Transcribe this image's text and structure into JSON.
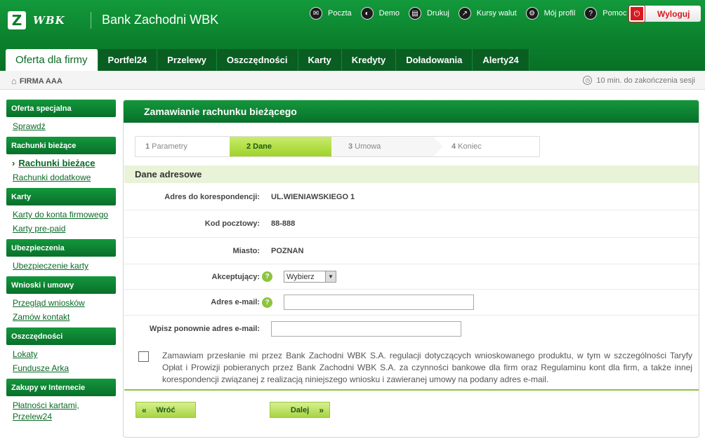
{
  "brand": {
    "logo_mark": "Z",
    "logo_text": "WBK",
    "bank_name": "Bank Zachodni WBK"
  },
  "top_links": [
    {
      "label": "Poczta",
      "icon": "mail-icon",
      "glyph": "✉"
    },
    {
      "label": "Demo",
      "icon": "demo-icon",
      "glyph": "◐"
    },
    {
      "label": "Drukuj",
      "icon": "print-icon",
      "glyph": "▤"
    },
    {
      "label": "Kursy walut",
      "icon": "chart-icon",
      "glyph": "↗"
    },
    {
      "label": "Mój profil",
      "icon": "gear-icon",
      "glyph": "⚙"
    },
    {
      "label": "Pomoc",
      "icon": "help-icon",
      "glyph": "?"
    }
  ],
  "logout": {
    "label": "Wyloguj",
    "glyph": "⏻"
  },
  "tabs": [
    {
      "label": "Oferta dla firmy",
      "active": true
    },
    {
      "label": "Portfel24"
    },
    {
      "label": "Przelewy"
    },
    {
      "label": "Oszczędności"
    },
    {
      "label": "Karty"
    },
    {
      "label": "Kredyty"
    },
    {
      "label": "Doładowania"
    },
    {
      "label": "Alerty24"
    }
  ],
  "subbar": {
    "firm_name": "FIRMA AAA",
    "session": "10 min. do zakończenia sesji"
  },
  "sidebar": [
    {
      "title": "Oferta specjalna",
      "items": [
        {
          "label": "Sprawdź"
        }
      ]
    },
    {
      "title": "Rachunki bieżące",
      "items": [
        {
          "label": "Rachunki bieżące",
          "current": true
        },
        {
          "label": "Rachunki dodatkowe"
        }
      ]
    },
    {
      "title": "Karty",
      "items": [
        {
          "label": "Karty do konta firmowego"
        },
        {
          "label": "Karty pre-paid"
        }
      ]
    },
    {
      "title": "Ubezpieczenia",
      "items": [
        {
          "label": "Ubezpieczenie karty"
        }
      ]
    },
    {
      "title": "Wnioski i umowy",
      "items": [
        {
          "label": "Przegląd wniosków"
        },
        {
          "label": "Zamów kontakt"
        }
      ]
    },
    {
      "title": "Oszczędności",
      "items": [
        {
          "label": "Lokaty"
        },
        {
          "label": "Fundusze Arka"
        }
      ]
    },
    {
      "title": "Zakupy w Internecie",
      "items": [
        {
          "label": "Płatności kartami, Przelew24"
        }
      ]
    }
  ],
  "main": {
    "title": "Zamawianie rachunku bieżącego",
    "steps": [
      {
        "num": "1",
        "label": "Parametry"
      },
      {
        "num": "2",
        "label": "Dane"
      },
      {
        "num": "3",
        "label": "Umowa"
      },
      {
        "num": "4",
        "label": "Koniec"
      }
    ],
    "section_title": "Dane adresowe",
    "fields": {
      "address_label": "Adres do korespondencji:",
      "address_value": "UL.WIENIAWSKIEGO 1",
      "postal_label": "Kod pocztowy:",
      "postal_value": "88-888",
      "city_label": "Miasto:",
      "city_value": "POZNAN",
      "accepting_label": "Akceptujący:",
      "accepting_selected": "Wybierz",
      "email_label": "Adres e-mail:",
      "email_value": "",
      "email_repeat_label": "Wpisz ponownie adres e-mail:",
      "email_repeat_value": ""
    },
    "consent_text": "Zamawiam przesłanie mi przez Bank Zachodni WBK S.A. regulacji dotyczących wnioskowanego produktu, w tym w szczególności Taryfy Opłat i Prowizji pobieranych przez Bank Zachodni WBK S.A. za czynności bankowe dla firm oraz Regulaminu kont dla firm, a także innej korespondencji związanej z realizacją niniejszego wniosku i zawieranej umowy na podany adres e-mail.",
    "help_glyph": "?",
    "buttons": {
      "back_label": "Wróć",
      "next_label": "Dalej",
      "back_arrow": "«",
      "next_arrow": "»"
    }
  }
}
